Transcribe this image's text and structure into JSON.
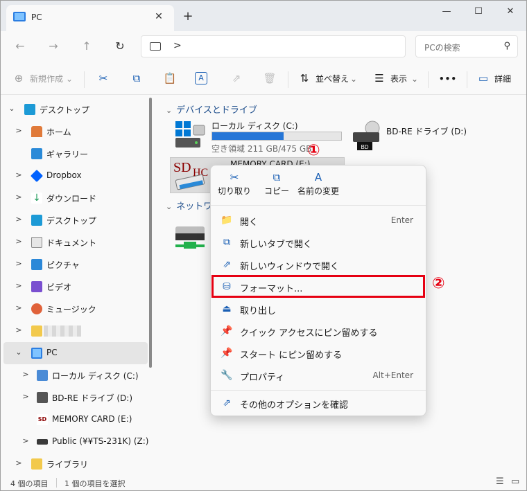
{
  "window": {
    "tab_title": "PC",
    "tab_close": "✕",
    "new_tab": "+",
    "minimize": "—",
    "maximize": "☐",
    "close": "✕"
  },
  "nav": {
    "back": "←",
    "forward": "→",
    "up": "↑",
    "refresh": "↻",
    "breadcrumb_chevron": ">",
    "search_placeholder": "PCの検索",
    "search_icon": "⚲"
  },
  "toolbar": {
    "new_label": "新規作成",
    "new_icon": "⊕",
    "new_chevron": "⌄",
    "cut_icon": "✂",
    "copy_icon": "⧉",
    "paste_icon": "📋",
    "rename_icon": "A",
    "share_icon": "⇗",
    "delete_icon": "🗑",
    "sort_label": "並べ替え",
    "sort_icon": "⇅",
    "sort_chevron": "⌄",
    "view_label": "表示",
    "view_icon": "☰",
    "view_chevron": "⌄",
    "more_icon": "•••",
    "details_label": "詳細",
    "details_icon": "▭"
  },
  "sidebar": {
    "items": [
      {
        "label": "デスクトップ",
        "arrow": "⌄"
      },
      {
        "label": "ホーム",
        "arrow": ">"
      },
      {
        "label": "ギャラリー",
        "arrow": ""
      },
      {
        "label": "Dropbox",
        "arrow": ">"
      },
      {
        "label": "ダウンロード",
        "arrow": ">"
      },
      {
        "label": "デスクトップ",
        "arrow": ">"
      },
      {
        "label": "ドキュメント",
        "arrow": ">"
      },
      {
        "label": "ピクチャ",
        "arrow": ">"
      },
      {
        "label": "ビデオ",
        "arrow": ">"
      },
      {
        "label": "ミュージック",
        "arrow": ">"
      },
      {
        "label": "",
        "arrow": ">"
      },
      {
        "label": "PC",
        "arrow": "⌄"
      },
      {
        "label": "ローカル ディスク (C:)",
        "arrow": ">"
      },
      {
        "label": "BD-RE ドライブ (D:)",
        "arrow": ">"
      },
      {
        "label": "MEMORY CARD (E:)",
        "arrow": ""
      },
      {
        "label": "Public (¥¥TS-231K) (Z:)",
        "arrow": ">"
      },
      {
        "label": "ライブラリ",
        "arrow": ">"
      }
    ]
  },
  "main": {
    "devices_header": "デバイスとドライブ",
    "network_header": "ネットワー",
    "group_chevron": "⌄",
    "c_drive": {
      "name": "ローカル ディスク (C:)",
      "free": "空き領域 211 GB/475 GB",
      "used_fraction": 0.556
    },
    "d_drive": {
      "name": "BD-RE ドライブ (D:)",
      "badge": "BD"
    },
    "e_drive": {
      "name": "MEMORY CARD (E:)",
      "logo": "SDHC"
    }
  },
  "context_menu": {
    "cut": {
      "icon": "✂",
      "label": "切り取り"
    },
    "copy": {
      "icon": "⧉",
      "label": "コピー"
    },
    "rename": {
      "icon": "A",
      "label": "名前の変更"
    },
    "items": [
      {
        "icon": "📁",
        "label": "開く",
        "shortcut": "Enter"
      },
      {
        "icon": "⧉",
        "label": "新しいタブで開く",
        "shortcut": ""
      },
      {
        "icon": "⇗",
        "label": "新しいウィンドウで開く",
        "shortcut": ""
      },
      {
        "icon": "⛁",
        "label": "フォーマット...",
        "shortcut": ""
      },
      {
        "icon": "⏏",
        "label": "取り出し",
        "shortcut": ""
      },
      {
        "icon": "📌",
        "label": "クイック アクセスにピン留めする",
        "shortcut": ""
      },
      {
        "icon": "📌",
        "label": "スタート にピン留めする",
        "shortcut": ""
      },
      {
        "icon": "🔧",
        "label": "プロパティ",
        "shortcut": "Alt+Enter"
      },
      {
        "icon": "⇗",
        "label": "その他のオプションを確認",
        "shortcut": ""
      }
    ]
  },
  "annotations": {
    "marker1": "①",
    "marker2": "②"
  },
  "status": {
    "count": "4 個の項目",
    "selected": "1 個の項目を選択",
    "list_icon": "☰",
    "tile_icon": "▭"
  },
  "colors": {
    "accent": "#2676d7",
    "highlight": "#e60012",
    "header_blue": "#1e4e8c"
  }
}
